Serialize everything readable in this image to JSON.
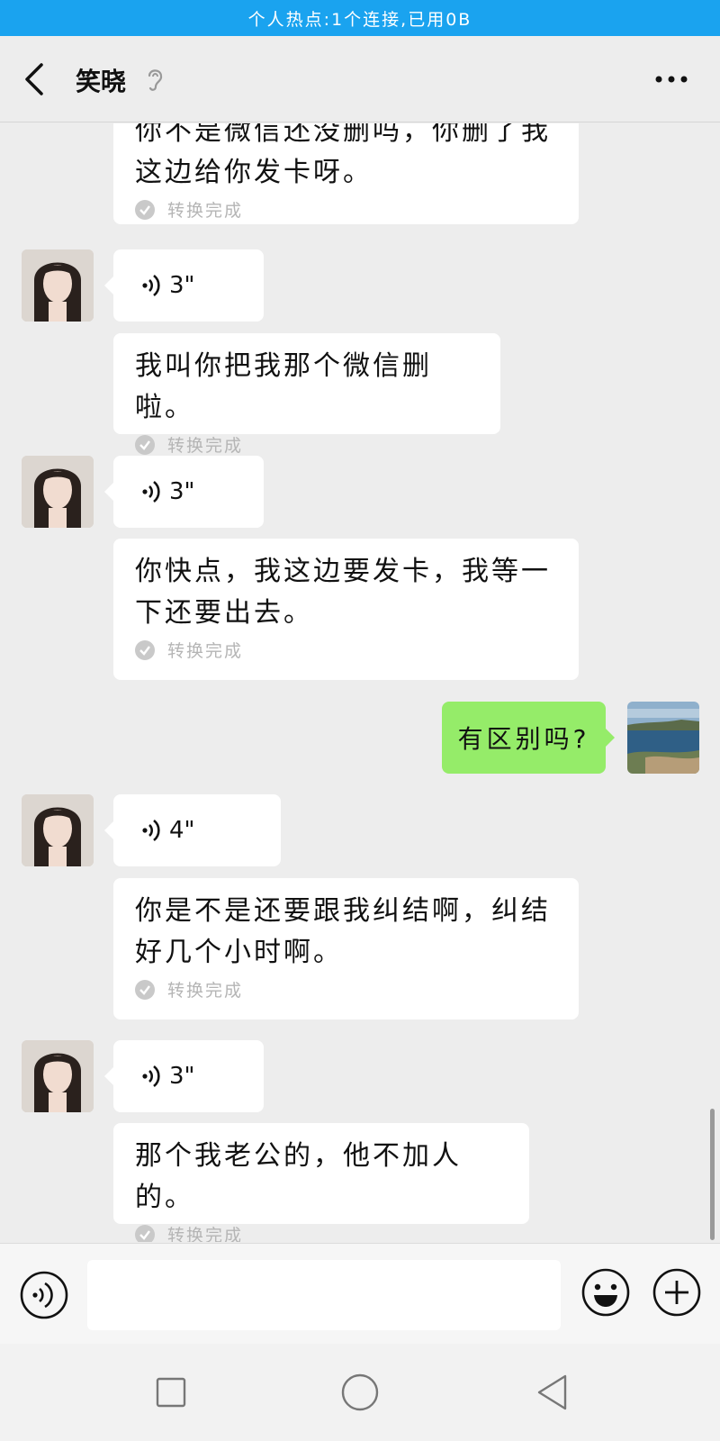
{
  "status_bar": {
    "hotspot_text": "个人热点:1个连接,已用0B"
  },
  "header": {
    "title": "笑晓",
    "back_icon": "chevron-left-icon",
    "ear_icon": "ear-icon",
    "more_icon": "more-dots-icon"
  },
  "messages": [
    {
      "type": "transcript",
      "text": "你不是微信还没删吗，你删了我这边给你发卡呀。",
      "status": "转换完成"
    },
    {
      "type": "voice",
      "duration": "3\""
    },
    {
      "type": "transcript",
      "text": "我叫你把我那个微信删啦。",
      "status": "转换完成"
    },
    {
      "type": "voice",
      "duration": "3\""
    },
    {
      "type": "transcript",
      "text": "你快点，我这边要发卡，我等一下还要出去。",
      "status": "转换完成"
    },
    {
      "type": "sent",
      "text": "有区别吗?"
    },
    {
      "type": "voice",
      "duration": "4\""
    },
    {
      "type": "transcript",
      "text": "你是不是还要跟我纠结啊，纠结好几个小时啊。",
      "status": "转换完成"
    },
    {
      "type": "voice",
      "duration": "3\""
    },
    {
      "type": "transcript",
      "text": "那个我老公的，他不加人的。",
      "status": "转换完成"
    }
  ],
  "input_bar": {
    "value": "",
    "voice_icon": "voice-input-icon",
    "emoji_icon": "emoji-icon",
    "plus_icon": "plus-icon"
  },
  "nav_bar": {
    "recent_icon": "square-icon",
    "home_icon": "circle-icon",
    "back_icon": "triangle-back-icon"
  },
  "colors": {
    "hotspot_bar": "#1aa3ef",
    "sent_bubble": "#95ec69",
    "chat_background": "#ededed"
  }
}
